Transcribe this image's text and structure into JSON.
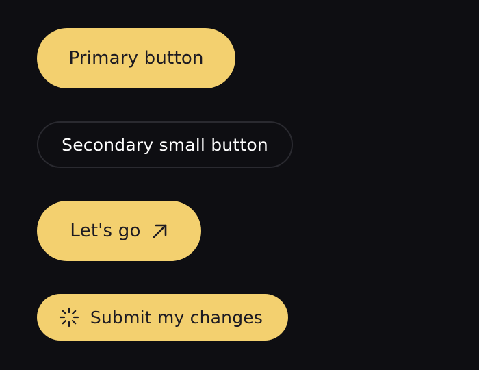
{
  "colors": {
    "background": "#0e0e12",
    "primary_button": "#f3d06f",
    "primary_text": "#1c1a22",
    "secondary_text": "#ffffff",
    "secondary_border": "#2a2a30"
  },
  "buttons": {
    "primary": {
      "label": "Primary button"
    },
    "secondary": {
      "label": "Secondary small button"
    },
    "lets_go": {
      "label": "Let's go",
      "icon": "arrow-up-right-icon"
    },
    "submit": {
      "label": "Submit my changes",
      "icon": "spinner-icon"
    }
  }
}
